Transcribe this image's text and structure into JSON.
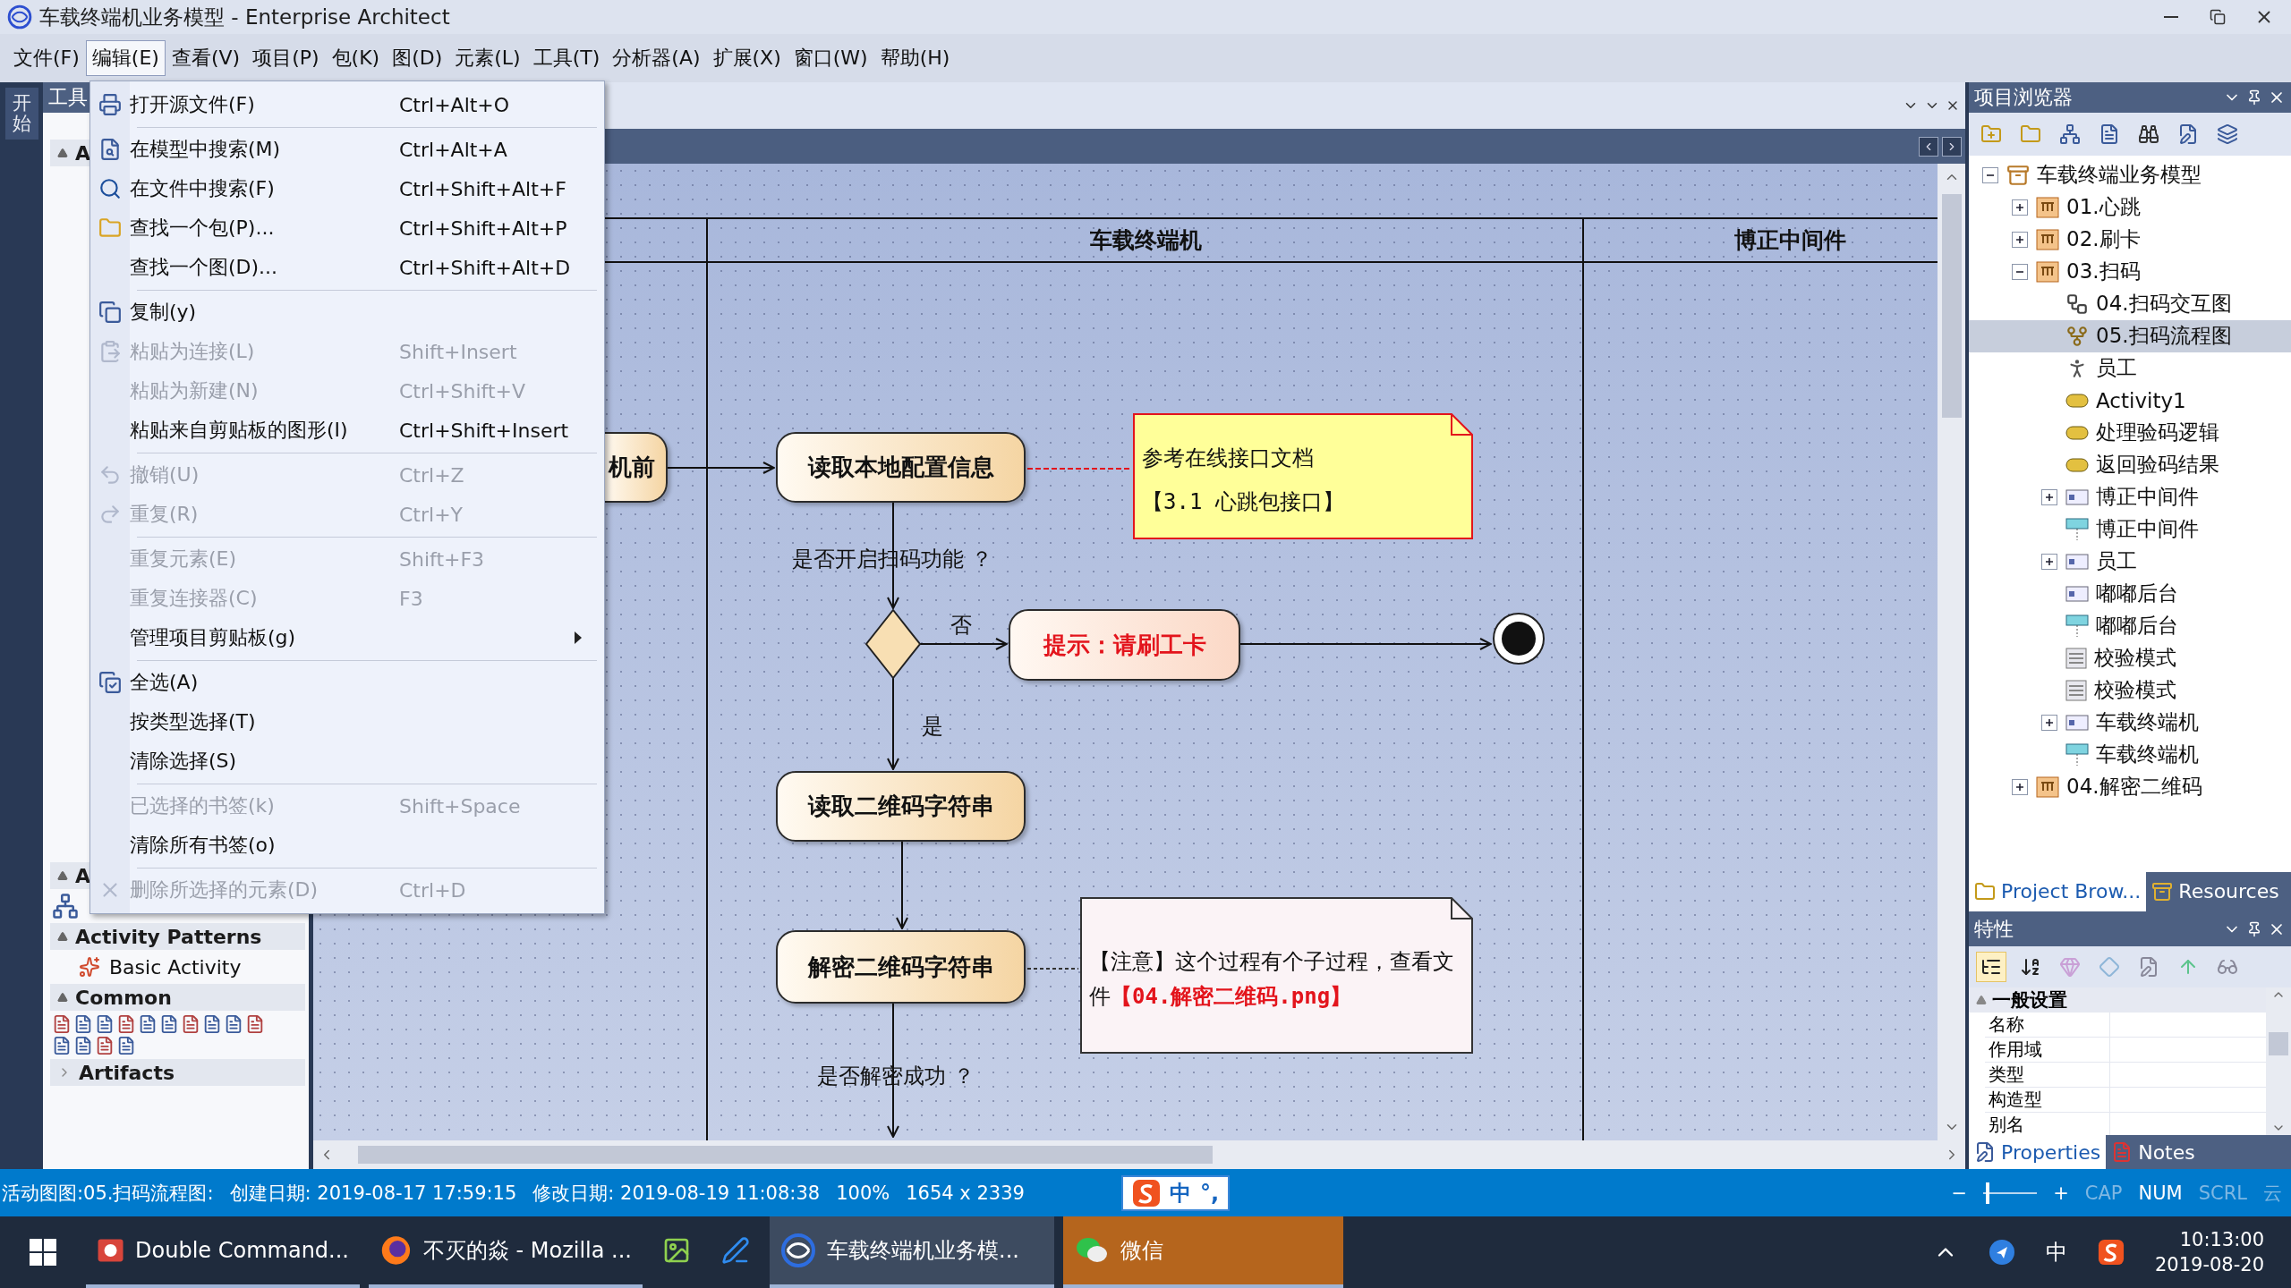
{
  "window": {
    "title": "车载终端机业务模型 - Enterprise Architect"
  },
  "menu_bar": [
    {
      "label": "文件(F)",
      "selected": false
    },
    {
      "label": "编辑(E)",
      "selected": true
    },
    {
      "label": "查看(V)",
      "selected": false
    },
    {
      "label": "项目(P)",
      "selected": false
    },
    {
      "label": "包(K)",
      "selected": false
    },
    {
      "label": "图(D)",
      "selected": false
    },
    {
      "label": "元素(L)",
      "selected": false
    },
    {
      "label": "工具(T)",
      "selected": false
    },
    {
      "label": "分析器(A)",
      "selected": false
    },
    {
      "label": "扩展(X)",
      "selected": false
    },
    {
      "label": "窗口(W)",
      "selected": false
    },
    {
      "label": "帮助(H)",
      "selected": false
    }
  ],
  "side_tab": {
    "label": "开始"
  },
  "toolbox": {
    "title": "工具",
    "groups": [
      {
        "label": "A"
      },
      {
        "label": "A"
      }
    ],
    "sections": [
      {
        "label": "Activity Patterns",
        "expanded": true,
        "items": [
          "Basic Activity"
        ]
      },
      {
        "label": "Common",
        "expanded": true
      },
      {
        "label": "Artifacts",
        "expanded": false
      }
    ]
  },
  "edit_menu": {
    "groups": [
      [
        {
          "label": "打开源文件(F)",
          "shortcut": "Ctrl+Alt+O",
          "disabled": false
        }
      ],
      [
        {
          "label": "在模型中搜索(M)",
          "shortcut": "Ctrl+Alt+A",
          "disabled": false
        },
        {
          "label": "在文件中搜索(F)",
          "shortcut": "Ctrl+Shift+Alt+F",
          "disabled": false
        },
        {
          "label": "查找一个包(P)...",
          "shortcut": "Ctrl+Shift+Alt+P",
          "disabled": false
        },
        {
          "label": "查找一个图(D)...",
          "shortcut": "Ctrl+Shift+Alt+D",
          "disabled": false
        }
      ],
      [
        {
          "label": "复制(y)",
          "disabled": false
        },
        {
          "label": "粘贴为连接(L)",
          "shortcut": "Shift+Insert",
          "disabled": true
        },
        {
          "label": "粘贴为新建(N)",
          "shortcut": "Ctrl+Shift+V",
          "disabled": true
        },
        {
          "label": "粘贴来自剪贴板的图形(I)",
          "shortcut": "Ctrl+Shift+Insert",
          "disabled": false
        }
      ],
      [
        {
          "label": "撤销(U)",
          "shortcut": "Ctrl+Z",
          "disabled": true
        },
        {
          "label": "重复(R)",
          "shortcut": "Ctrl+Y",
          "disabled": true
        }
      ],
      [
        {
          "label": "重复元素(E)",
          "shortcut": "Shift+F3",
          "disabled": true
        },
        {
          "label": "重复连接器(C)",
          "shortcut": "F3",
          "disabled": true
        },
        {
          "label": "管理项目剪贴板(g)",
          "disabled": false,
          "submenu": true
        }
      ],
      [
        {
          "label": "全选(A)",
          "disabled": false
        },
        {
          "label": "按类型选择(T)",
          "disabled": false
        },
        {
          "label": "清除选择(S)",
          "disabled": false
        }
      ],
      [
        {
          "label": "已选择的书签(k)",
          "shortcut": "Shift+Space",
          "disabled": true
        },
        {
          "label": "清除所有书签(o)",
          "disabled": false
        }
      ],
      [
        {
          "label": "删除所选择的元素(D)",
          "shortcut": "Ctrl+D",
          "disabled": true
        }
      ]
    ]
  },
  "diagram": {
    "lanes": [
      {
        "name": "车载终端机"
      },
      {
        "name": "博正中间件"
      }
    ],
    "actions": [
      {
        "label": "机前",
        "kind": "action"
      },
      {
        "label": "读取本地配置信息",
        "kind": "action"
      },
      {
        "label": "提示：请刷工卡",
        "kind": "alert"
      },
      {
        "label": "读取二维码字符串",
        "kind": "action"
      },
      {
        "label": "解密二维码字符串",
        "kind": "action"
      }
    ],
    "guards": [
      "是否开启扫码功能 ？",
      "否",
      "是",
      "是否解密成功 ？"
    ],
    "notes": [
      {
        "kind": "reference",
        "lines": [
          "参考在线接口文档",
          "【3.1 心跳包接口】"
        ]
      },
      {
        "kind": "remark",
        "lines": [
          "【注意】这个过程有个子过程，查看文件**【04.解密二维码.png】**"
        ]
      }
    ]
  },
  "project_browser": {
    "title": "项目浏览器",
    "tree": [
      {
        "label": "车载终端业务模型",
        "kind": "model",
        "expanded": true,
        "selected": false,
        "children": [
          {
            "label": "01.心跳",
            "kind": "package",
            "expanded": false,
            "selected": false
          },
          {
            "label": "02.刷卡",
            "kind": "package",
            "expanded": false,
            "selected": false
          },
          {
            "label": "03.扫码",
            "kind": "package",
            "expanded": true,
            "selected": false,
            "children": [
              {
                "label": "04.扫码交互图",
                "kind": "sequence",
                "selected": false
              },
              {
                "label": "05.扫码流程图",
                "kind": "activity-diagram",
                "selected": true
              },
              {
                "label": "员工",
                "kind": "actor",
                "selected": false
              },
              {
                "label": "Activity1",
                "kind": "activity",
                "selected": false
              },
              {
                "label": "处理验码逻辑",
                "kind": "activity",
                "selected": false
              },
              {
                "label": "返回验码结果",
                "kind": "activity",
                "selected": false
              },
              {
                "label": "博正中间件",
                "kind": "class",
                "expanded": false,
                "selected": false
              },
              {
                "label": "博正中间件",
                "kind": "lifeline",
                "selected": false
              },
              {
                "label": "员工",
                "kind": "class",
                "expanded": false,
                "selected": false
              },
              {
                "label": "嘟嘟后台",
                "kind": "class",
                "selected": false
              },
              {
                "label": "嘟嘟后台",
                "kind": "lifeline",
                "selected": false
              },
              {
                "label": "校验模式",
                "kind": "list",
                "selected": false
              },
              {
                "label": "校验模式",
                "kind": "list",
                "selected": false
              },
              {
                "label": "车载终端机",
                "kind": "class",
                "expanded": false,
                "selected": false
              },
              {
                "label": "车载终端机",
                "kind": "lifeline",
                "selected": false
              }
            ]
          },
          {
            "label": "04.解密二维码",
            "kind": "package",
            "expanded": false,
            "selected": false
          }
        ]
      }
    ],
    "tabs": [
      {
        "label": "Project Brow...",
        "selected": true
      },
      {
        "label": "Resources",
        "selected": false
      }
    ]
  },
  "properties": {
    "title": "特性",
    "group": {
      "label": "一般设置",
      "expanded": true
    },
    "rows": [
      "名称",
      "作用域",
      "类型",
      "构造型",
      "别名"
    ],
    "tabs": [
      {
        "label": "Properties",
        "selected": true
      },
      {
        "label": "Notes",
        "selected": false
      }
    ]
  },
  "status_bar": {
    "diagram": "活动图图:05.扫码流程图:",
    "created": "创建日期: 2019-08-17 17:59:15",
    "modified": "修改日期: 2019-08-19 11:08:38",
    "zoom": "100%",
    "size": "1654 x 2339",
    "ime": {
      "mode": "中",
      "punctuation": "°,"
    },
    "zoom_out": "−",
    "zoom_in": "+",
    "zoom_slider": {
      "level": 0.05
    },
    "indicators": [
      {
        "label": "CAP",
        "on": false
      },
      {
        "label": "NUM",
        "on": true
      },
      {
        "label": "SCRL",
        "on": false
      }
    ],
    "cloud": "云"
  },
  "taskbar": {
    "apps": [
      {
        "label": "Double Command...",
        "selected": false,
        "running": true,
        "attention": false
      },
      {
        "label": "不灭的焱 - Mozilla ...",
        "selected": false,
        "running": true,
        "attention": false
      },
      {
        "selected": false,
        "running": false,
        "attention": false
      },
      {
        "selected": false,
        "running": false,
        "attention": false
      },
      {
        "label": "车载终端机业务模...",
        "selected": true,
        "running": true,
        "attention": false
      },
      {
        "label": "微信",
        "selected": false,
        "running": true,
        "attention": true
      }
    ],
    "tray": {
      "language": "中",
      "time": "10:13:00",
      "date": "2019-08-20"
    }
  }
}
